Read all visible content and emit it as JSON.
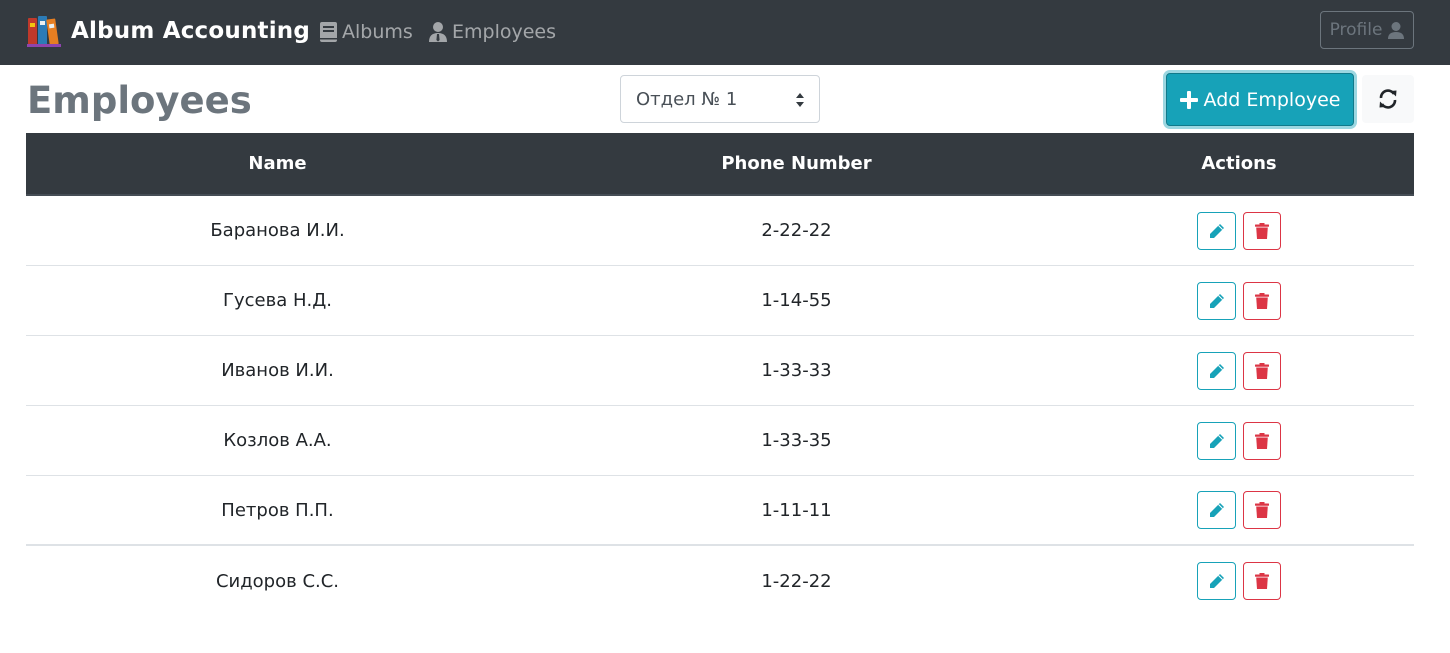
{
  "navbar": {
    "brand": "Album Accounting",
    "links": [
      {
        "label": "Albums",
        "icon": "book-icon"
      },
      {
        "label": "Employees",
        "icon": "user-tie-icon"
      }
    ],
    "profile_label": "Profile",
    "bg_color": "#343a40"
  },
  "header": {
    "title": "Employees",
    "department_selected": "Отдел № 1",
    "add_button_label": "Add Employee",
    "refresh_icon": "sync-icon",
    "accent_color": "#17a2b8"
  },
  "table": {
    "columns": [
      "Name",
      "Phone Number",
      "Actions"
    ],
    "rows": [
      {
        "name": "Баранова И.И.",
        "phone": "2-22-22"
      },
      {
        "name": "Гусева Н.Д.",
        "phone": "1-14-55"
      },
      {
        "name": "Иванов И.И.",
        "phone": "1-33-33"
      },
      {
        "name": "Козлов А.А.",
        "phone": "1-33-35"
      },
      {
        "name": "Петров П.П.",
        "phone": "1-11-11"
      },
      {
        "name": "Сидоров С.С.",
        "phone": "1-22-22"
      }
    ],
    "edit_icon": "pencil-icon",
    "delete_icon": "trash-icon",
    "danger_color": "#dc3545"
  }
}
